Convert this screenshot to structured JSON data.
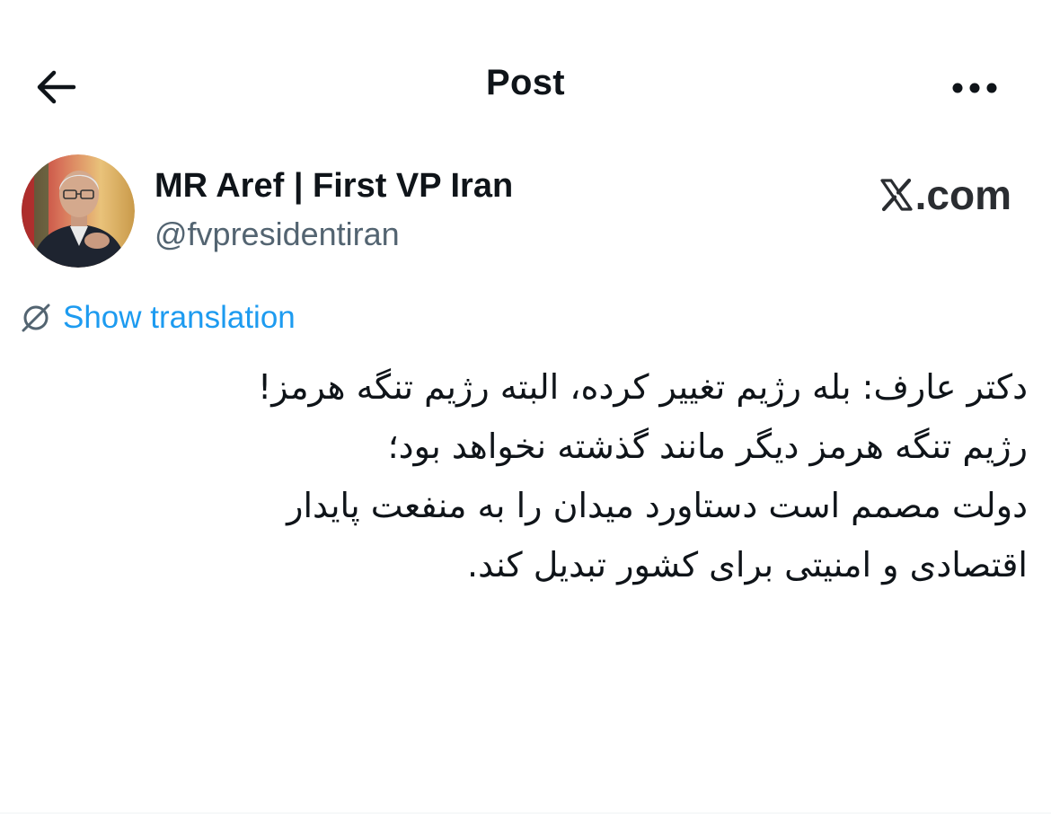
{
  "header": {
    "title": "Post",
    "back_icon": "arrow-left-icon",
    "more_icon": "more-horizontal-icon"
  },
  "author": {
    "name": "MR Aref | First VP Iran",
    "handle": "@fvpresidentiran",
    "avatar_icon": "profile-photo"
  },
  "watermark": {
    "logo_text": "𝕏",
    "text": ".com"
  },
  "translation": {
    "icon": "globe-translate-icon",
    "label": "Show translation"
  },
  "tweet": {
    "lines": [
      "دکتر عارف: بله رژیم تغییر کرده، البته رژیم تنگه هرمز!",
      "رژیم تنگه هرمز دیگر مانند گذشته نخواهد بود؛",
      "دولت مصمم است دستاورد میدان را به منفعت پایدار",
      "اقتصادی و امنیتی برای کشور تبدیل کند."
    ]
  },
  "colors": {
    "text": "#0f1419",
    "secondary": "#536471",
    "link": "#1d9bf0"
  }
}
